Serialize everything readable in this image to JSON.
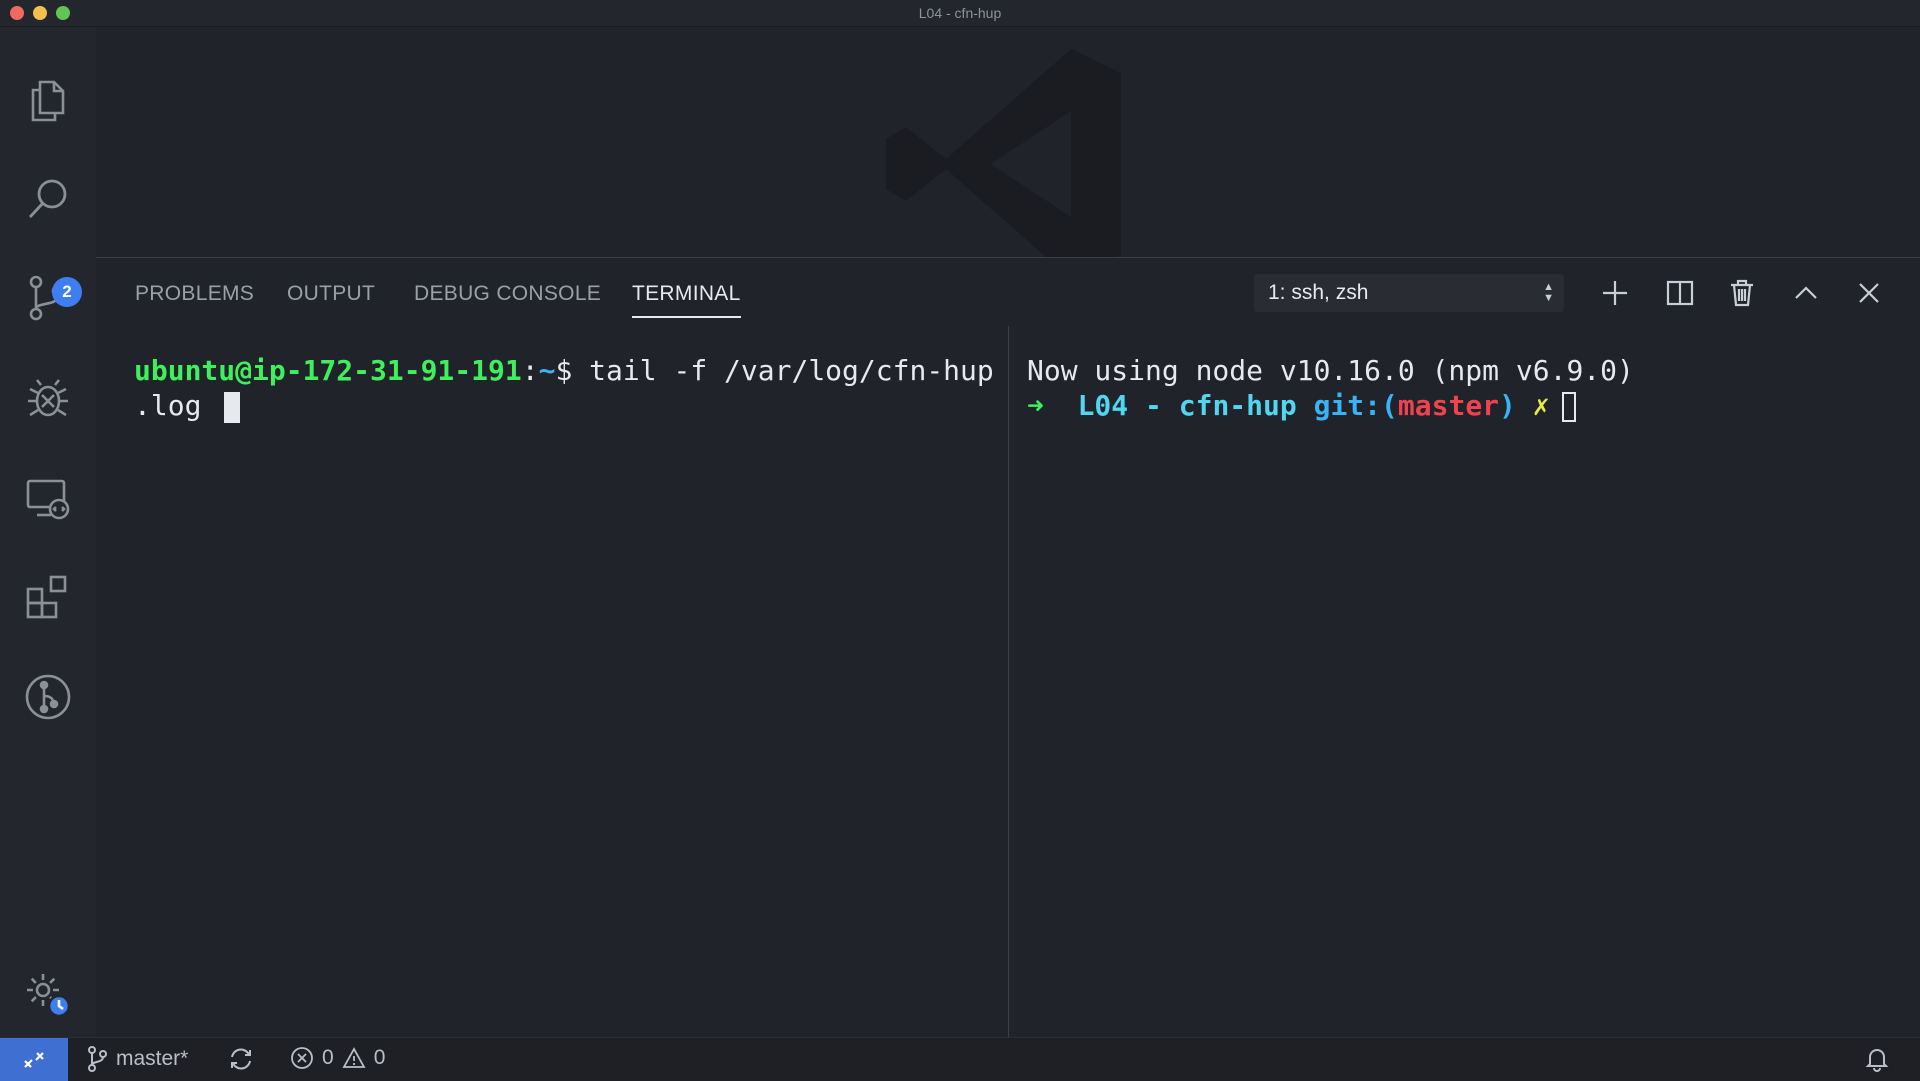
{
  "window": {
    "title": "L04 - cfn-hup"
  },
  "activity_bar": {
    "items": [
      {
        "name": "explorer",
        "icon": "files-icon"
      },
      {
        "name": "search",
        "icon": "search-icon"
      },
      {
        "name": "source-control",
        "icon": "source-control-icon",
        "badge": "2"
      },
      {
        "name": "debug",
        "icon": "debug-icon"
      },
      {
        "name": "remote-explorer",
        "icon": "remote-explorer-icon"
      },
      {
        "name": "extensions",
        "icon": "extensions-icon"
      },
      {
        "name": "git-graph",
        "icon": "git-graph-icon"
      }
    ],
    "manage_icon": "gear-clock-icon"
  },
  "panel": {
    "tabs": [
      {
        "label": "PROBLEMS"
      },
      {
        "label": "OUTPUT"
      },
      {
        "label": "DEBUG CONSOLE"
      },
      {
        "label": "TERMINAL",
        "active": true
      }
    ],
    "terminal_select": "1: ssh, zsh",
    "tools": [
      "plus-icon",
      "split-icon",
      "trash-icon",
      "chevron-up-icon",
      "close-icon"
    ]
  },
  "terminal_left": {
    "user_host": "ubuntu@ip-172-31-91-191",
    "colon": ":",
    "path": "~",
    "prompt": "$ ",
    "command_line1": "tail -f /var/log/cfn-hup",
    "command_line2": ".log "
  },
  "terminal_right": {
    "line1": "Now using node v10.16.0 (npm v6.9.0)",
    "arrow": "➜",
    "dir": "L04 - cfn-hup",
    "git_prefix": "git:(",
    "branch": "master",
    "git_suffix": ")",
    "dirty": "✗"
  },
  "status_bar": {
    "branch": "master*",
    "errors": "0",
    "warnings": "0"
  },
  "colors": {
    "accent": "#3f6fd0",
    "badge": "#3f7ef0",
    "prompt_green": "#3ef05c",
    "prompt_blue": "#39b3f5",
    "git_cyan": "#52d5f0",
    "git_red": "#f0434f"
  }
}
